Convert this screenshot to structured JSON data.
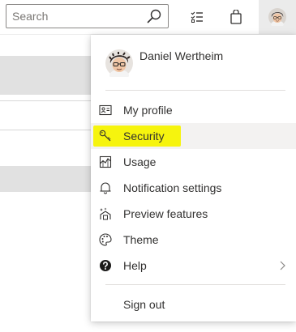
{
  "search": {
    "placeholder": "Search"
  },
  "topbar": {
    "icons": [
      "search-icon",
      "checklist-icon",
      "shopping-bag-icon",
      "avatar"
    ]
  },
  "account_menu": {
    "user_name": "Daniel Wertheim",
    "items": [
      {
        "label": "My profile",
        "icon": "contact-card-icon"
      },
      {
        "label": "Security",
        "icon": "key-icon",
        "highlighted": true,
        "highlight_color": "#f6f40e"
      },
      {
        "label": "Usage",
        "icon": "usage-chart-icon"
      },
      {
        "label": "Notification settings",
        "icon": "bell-icon"
      },
      {
        "label": "Preview features",
        "icon": "preview-features-icon"
      },
      {
        "label": "Theme",
        "icon": "palette-icon"
      },
      {
        "label": "Help",
        "icon": "help-icon",
        "has_submenu": true
      }
    ],
    "sign_out": "Sign out"
  },
  "colors": {
    "hover_background": "#f3f2f1",
    "highlight": "#f6f40e",
    "text": "#323130"
  }
}
